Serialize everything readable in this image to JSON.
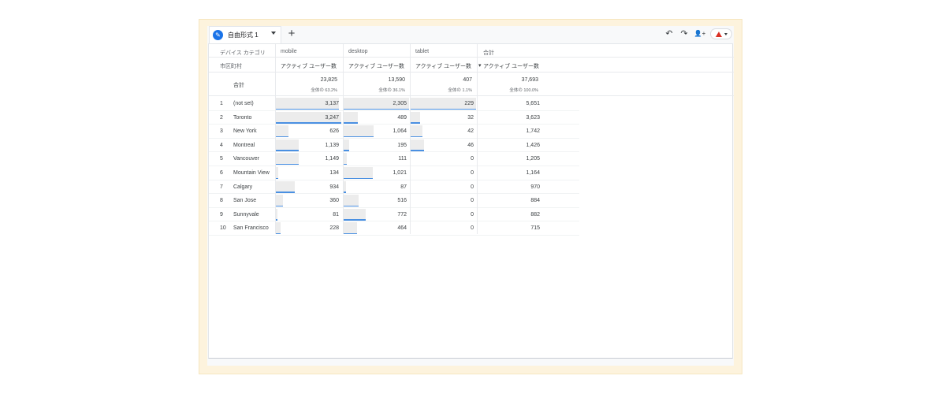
{
  "tab": {
    "label": "自由形式 1",
    "add_label": "+"
  },
  "toolbar": {
    "undo": "↶",
    "redo": "↷",
    "share": "👤+"
  },
  "headers": {
    "dimension_label": "デバイス カテゴリ",
    "row_dimension_label": "市区町村",
    "columns": [
      {
        "name": "mobile",
        "metric": "アクティブ ユーザー数"
      },
      {
        "name": "desktop",
        "metric": "アクティブ ユーザー数"
      },
      {
        "name": "tablet",
        "metric": "アクティブ ユーザー数"
      },
      {
        "name": "合計",
        "metric": "アクティブ ユーザー数",
        "sort_indicator": "▾"
      }
    ]
  },
  "totals": {
    "label": "合計",
    "values": [
      "23,825",
      "13,590",
      "407",
      "37,693"
    ],
    "shares": [
      "全体の 63.2%",
      "全体の 36.1%",
      "全体の 1.1%",
      "全体の 100.0%"
    ]
  },
  "rows": [
    {
      "index": "1",
      "city": "(not set)",
      "values": [
        3137,
        2305,
        229,
        5651
      ],
      "labels": [
        "3,137",
        "2,305",
        "229",
        "5,651"
      ]
    },
    {
      "index": "2",
      "city": "Toronto",
      "values": [
        3247,
        489,
        32,
        3623
      ],
      "labels": [
        "3,247",
        "489",
        "32",
        "3,623"
      ]
    },
    {
      "index": "3",
      "city": "New York",
      "values": [
        626,
        1064,
        42,
        1742
      ],
      "labels": [
        "626",
        "1,064",
        "42",
        "1,742"
      ]
    },
    {
      "index": "4",
      "city": "Montreal",
      "values": [
        1139,
        195,
        46,
        1426
      ],
      "labels": [
        "1,139",
        "195",
        "46",
        "1,426"
      ]
    },
    {
      "index": "5",
      "city": "Vancouver",
      "values": [
        1149,
        111,
        0,
        1205
      ],
      "labels": [
        "1,149",
        "111",
        "0",
        "1,205"
      ]
    },
    {
      "index": "6",
      "city": "Mountain View",
      "values": [
        134,
        1021,
        0,
        1164
      ],
      "labels": [
        "134",
        "1,021",
        "0",
        "1,164"
      ]
    },
    {
      "index": "7",
      "city": "Calgary",
      "values": [
        934,
        87,
        0,
        970
      ],
      "labels": [
        "934",
        "87",
        "0",
        "970"
      ]
    },
    {
      "index": "8",
      "city": "San Jose",
      "values": [
        360,
        516,
        0,
        884
      ],
      "labels": [
        "360",
        "516",
        "0",
        "884"
      ]
    },
    {
      "index": "9",
      "city": "Sunnyvale",
      "values": [
        81,
        772,
        0,
        882
      ],
      "labels": [
        "81",
        "772",
        "0",
        "882"
      ]
    },
    {
      "index": "10",
      "city": "San Francisco",
      "values": [
        228,
        464,
        0,
        715
      ],
      "labels": [
        "228",
        "464",
        "0",
        "715"
      ]
    }
  ],
  "colors": {
    "accent": "#1a73e8",
    "bar_fill": "#ececec",
    "bar_line": "#4a90e2",
    "warning": "#d93025",
    "frame": "#fdf3dd"
  }
}
